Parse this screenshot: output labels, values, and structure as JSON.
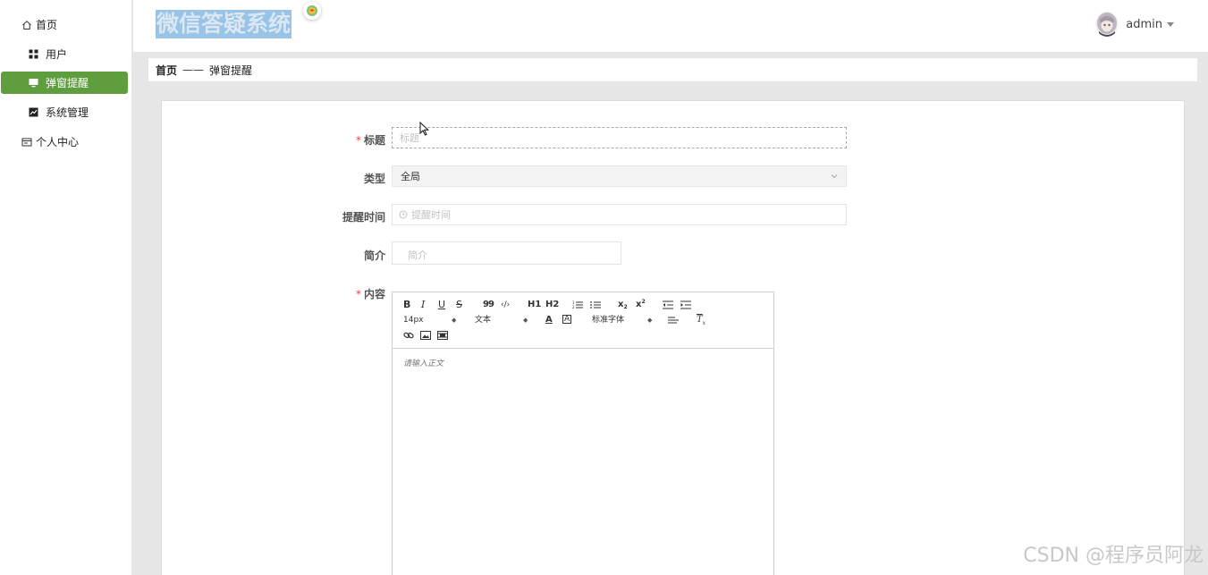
{
  "app": {
    "title": "微信答疑系统",
    "user": "admin"
  },
  "sidebar": {
    "items": [
      {
        "label": "首页",
        "icon": "home-icon"
      },
      {
        "label": "用户",
        "icon": "grid-icon"
      },
      {
        "label": "弹窗提醒",
        "icon": "monitor-icon",
        "active": true
      },
      {
        "label": "系统管理",
        "icon": "chart-icon"
      },
      {
        "label": "个人中心",
        "icon": "id-card-icon"
      }
    ]
  },
  "breadcrumb": {
    "home": "首页",
    "separator": "——",
    "current": "弹窗提醒"
  },
  "form": {
    "title_label": "标题",
    "title_placeholder": "标题",
    "type_label": "类型",
    "type_value": "全局",
    "time_label": "提醒时间",
    "time_placeholder": "提醒时间",
    "intro_label": "简介",
    "intro_placeholder": "简介",
    "content_label": "内容",
    "required_mark": "*"
  },
  "editor": {
    "buttons": {
      "bold": "B",
      "italic": "I",
      "underline": "U",
      "strike": "S",
      "blockquote": "99",
      "code": "‹/›",
      "h1": "H1",
      "h2": "H2",
      "sub": "x2",
      "sup": "x2",
      "clean": "Tx"
    },
    "size_value": "14px",
    "header_value": "文本",
    "font_value": "标准字体",
    "placeholder": "请输入正文"
  },
  "watermark": "CSDN @程序员阿龙",
  "colors": {
    "active_nav": "#5f9e3e",
    "required": "#e2463c",
    "title_highlight": "#99c4e8"
  }
}
